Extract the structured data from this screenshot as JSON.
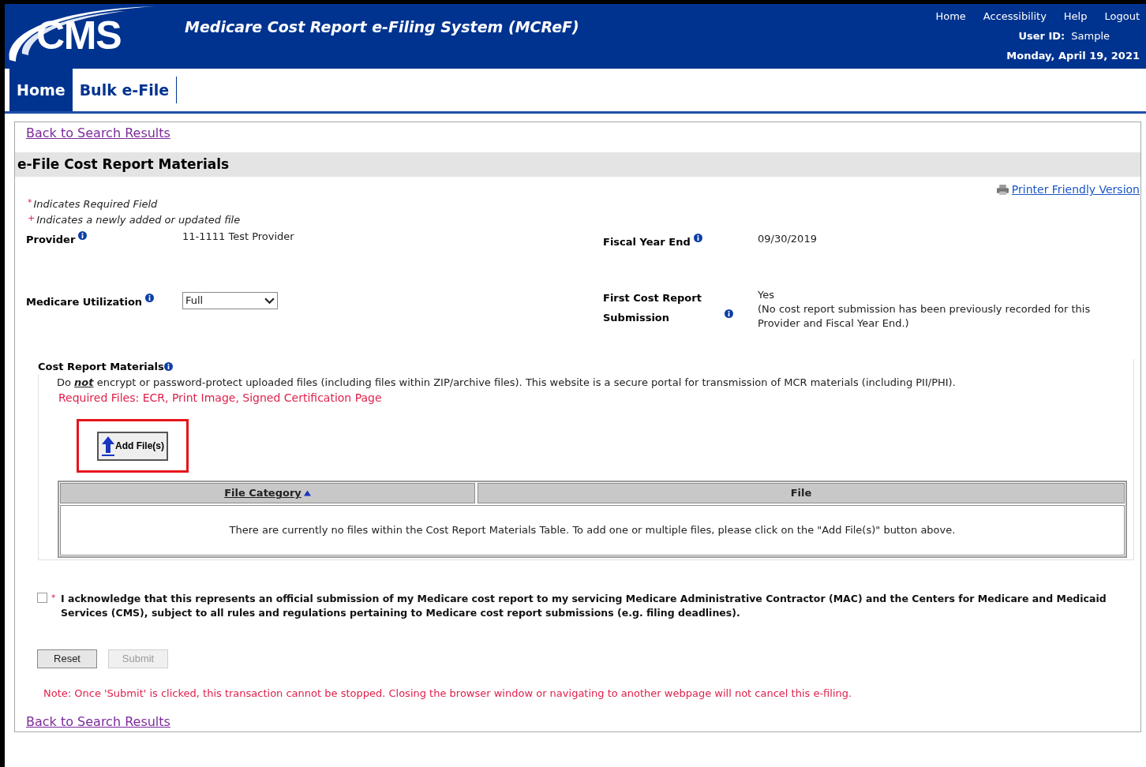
{
  "header": {
    "logo_text": "CMS",
    "title": "Medicare Cost Report e-Filing System (MCReF)",
    "links": [
      "Home",
      "Accessibility",
      "Help",
      "Logout"
    ],
    "user_label": "User ID:",
    "user_value": "Sample",
    "date": "Monday, April 19, 2021"
  },
  "tabs": [
    {
      "label": "Home",
      "selected": true
    },
    {
      "label": "Bulk e-File",
      "selected": false
    }
  ],
  "back_link_top": "Back to Search Results",
  "section_title": "e-File Cost Report Materials",
  "printer_link": "Printer Friendly Version",
  "legend": [
    {
      "marker": "*",
      "text": "Indicates Required Field"
    },
    {
      "marker": "+",
      "text": "Indicates a newly added or updated file"
    }
  ],
  "fields_left": [
    {
      "kind": "text",
      "label": "Provider",
      "value": "11-1111 Test Provider"
    },
    {
      "kind": "select",
      "label": "Medicare Utilization",
      "value": "Full"
    }
  ],
  "fields_right": [
    {
      "kind": "text",
      "label": "Fiscal Year End",
      "value": "09/30/2019"
    },
    {
      "kind": "text",
      "label": "First Cost Report Submission",
      "value": "Yes",
      "note": "(No cost report submission has been previously recorded for this Provider and Fiscal Year End.)"
    }
  ],
  "materials": {
    "title": "Cost Report Materials",
    "warning": "Do **not** encrypt or password-protect uploaded files (including files within ZIP/archive files). This website is a secure portal for transmission of MCR materials (including PII/PHI).",
    "required": "Required Files: ECR, Print Image, Signed Certification Page",
    "add_button": "Add File(s)",
    "highlighted": true,
    "table": {
      "columns": [
        {
          "label": "File Category",
          "sorted": true
        },
        {
          "label": "File",
          "sorted": false
        }
      ],
      "empty_message": "There are currently no files within the Cost Report Materials Table. To add one or multiple files, please click on the \"Add File(s)\" button above."
    }
  },
  "acknowledge": {
    "checked": false,
    "marker": "*",
    "text": "I acknowledge that this represents an official submission of my Medicare cost report to my servicing Medicare Administrative Contractor (MAC) and the Centers for Medicare and Medicaid Services (CMS), subject to all rules and regulations pertaining to Medicare cost report submissions (e.g. filing deadlines)."
  },
  "buttons": [
    {
      "label": "Reset",
      "disabled": false
    },
    {
      "label": "Submit",
      "disabled": true
    }
  ],
  "note": "Note: Once 'Submit' is clicked, this transaction cannot be stopped. Closing the browser window or navigating to another webpage will not cancel this e-filing.",
  "back_link_bottom": "Back to Search Results"
}
